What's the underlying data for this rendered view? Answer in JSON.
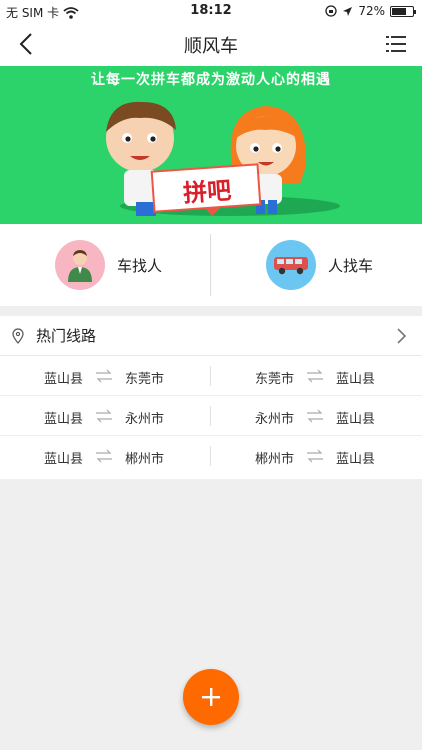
{
  "status_bar": {
    "carrier": "无 SIM 卡",
    "time": "18:12",
    "battery_percent": "72%",
    "battery_level": 0.72
  },
  "nav": {
    "title": "顺风车",
    "back_icon": "chevron-left-icon",
    "menu_icon": "list-icon"
  },
  "banner": {
    "slogan": "让每一次拼车都成为激动人心的相遇",
    "sign_text": "拼吧",
    "background": "#2bd36a"
  },
  "modes": [
    {
      "label": "车找人",
      "icon": "person-icon",
      "circle_color": "#f8b6c2"
    },
    {
      "label": "人找车",
      "icon": "van-icon",
      "circle_color": "#6cc6f2"
    }
  ],
  "routes": {
    "title": "热门线路",
    "pin_icon": "location-pin-icon",
    "arrow_icon": "chevron-right-icon",
    "swap_icon": "exchange-icon",
    "rows": [
      [
        {
          "from": "蓝山县",
          "to": "东莞市"
        },
        {
          "from": "东莞市",
          "to": "蓝山县"
        }
      ],
      [
        {
          "from": "蓝山县",
          "to": "永州市"
        },
        {
          "from": "永州市",
          "to": "蓝山县"
        }
      ],
      [
        {
          "from": "蓝山县",
          "to": "郴州市"
        },
        {
          "from": "郴州市",
          "to": "蓝山县"
        }
      ]
    ]
  },
  "fab": {
    "icon": "plus-icon",
    "color": "#ff6a00"
  }
}
